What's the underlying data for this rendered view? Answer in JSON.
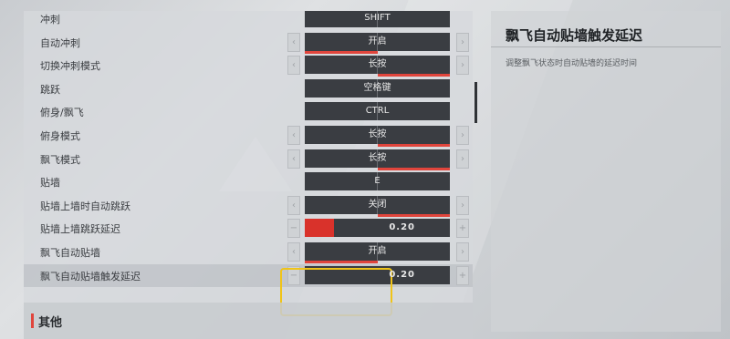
{
  "settings": {
    "rows": [
      {
        "label": "冲刺",
        "value": "SHIFT",
        "kind": "key",
        "arrows": false,
        "bar": "none"
      },
      {
        "label": "自动冲刺",
        "value": "开启",
        "kind": "toggle",
        "arrows": true,
        "bar": "left"
      },
      {
        "label": "切换冲刺模式",
        "value": "长按",
        "kind": "toggle",
        "arrows": true,
        "bar": "right"
      },
      {
        "label": "跳跃",
        "value": "空格键",
        "kind": "key",
        "arrows": false,
        "bar": "none"
      },
      {
        "label": "俯身/飘飞",
        "value": "CTRL",
        "kind": "key",
        "arrows": false,
        "bar": "none"
      },
      {
        "label": "俯身模式",
        "value": "长按",
        "kind": "toggle",
        "arrows": true,
        "bar": "right"
      },
      {
        "label": "飘飞模式",
        "value": "长按",
        "kind": "toggle",
        "arrows": true,
        "bar": "right"
      },
      {
        "label": "贴墙",
        "value": "E",
        "kind": "key",
        "arrows": false,
        "bar": "none"
      },
      {
        "label": "贴墙上墙时自动跳跃",
        "value": "关闭",
        "kind": "toggle",
        "arrows": true,
        "bar": "right"
      },
      {
        "label": "贴墙上墙跳跃延迟",
        "value": "0.20",
        "kind": "slider",
        "arrows": true,
        "bar": "none",
        "fill": 0.2
      },
      {
        "label": "飘飞自动贴墙",
        "value": "开启",
        "kind": "toggle",
        "arrows": true,
        "bar": "left"
      },
      {
        "label": "飘飞自动贴墙触发延迟",
        "value": "0.20",
        "kind": "slider",
        "arrows": true,
        "bar": "none",
        "fill": 0.0,
        "selected": true
      }
    ],
    "section_title": "其他"
  },
  "description": {
    "title": "飘飞自动贴墙触发延迟",
    "text": "调整飘飞状态时自动贴墙的延迟时间"
  },
  "icons": {
    "arrow_left": "chevron-left-icon",
    "arrow_right": "chevron-right-icon",
    "minus": "minus-icon",
    "plus": "plus-icon"
  },
  "colors": {
    "accent": "#e0453c",
    "control_bg": "#3a3d42",
    "highlight": "#f0c419"
  }
}
